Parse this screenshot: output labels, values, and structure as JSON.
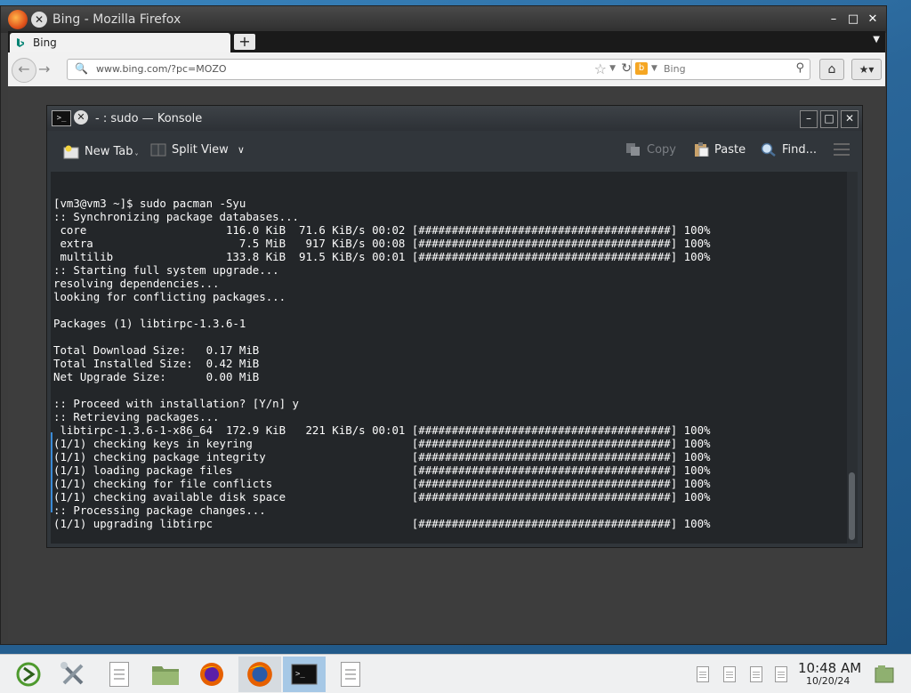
{
  "firefox": {
    "window_title": "Bing - Mozilla Firefox",
    "tab_label": "Bing",
    "new_tab_symbol": "+",
    "url": "www.bing.com/?pc=MOZO",
    "search_placeholder": "Bing",
    "buttons": {
      "minimize": "–",
      "maximize": "□",
      "close": "✕"
    }
  },
  "konsole": {
    "window_title": "- : sudo — Konsole",
    "toolbar": {
      "new_tab": "New Tab",
      "split_view": "Split View",
      "copy": "Copy",
      "paste": "Paste",
      "find": "Find..."
    },
    "terminal_lines": [
      "[vm3@vm3 ~]$ sudo pacman -Syu",
      ":: Synchronizing package databases...",
      " core                     116.0 KiB  71.6 KiB/s 00:02 [######################################] 100%",
      " extra                      7.5 MiB   917 KiB/s 00:08 [######################################] 100%",
      " multilib                 133.8 KiB  91.5 KiB/s 00:01 [######################################] 100%",
      ":: Starting full system upgrade...",
      "resolving dependencies...",
      "looking for conflicting packages...",
      "",
      "Packages (1) libtirpc-1.3.6-1",
      "",
      "Total Download Size:   0.17 MiB",
      "Total Installed Size:  0.42 MiB",
      "Net Upgrade Size:      0.00 MiB",
      "",
      ":: Proceed with installation? [Y/n] y",
      ":: Retrieving packages...",
      " libtirpc-1.3.6-1-x86_64  172.9 KiB   221 KiB/s 00:01 [######################################] 100%",
      "(1/1) checking keys in keyring                        [######################################] 100%",
      "(1/1) checking package integrity                      [######################################] 100%",
      "(1/1) loading package files                           [######################################] 100%",
      "(1/1) checking for file conflicts                     [######################################] 100%",
      "(1/1) checking available disk space                   [######################################] 100%",
      ":: Processing package changes...",
      "(1/1) upgrading libtirpc                              [######################################] 100%"
    ]
  },
  "taskbar": {
    "clock_time": "10:48 AM",
    "clock_date": "10/20/24"
  }
}
